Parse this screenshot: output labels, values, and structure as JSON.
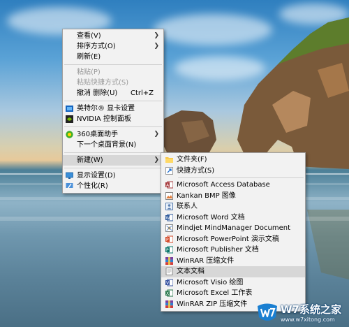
{
  "context_menu": {
    "items": [
      {
        "label": "查看(V)"
      },
      {
        "label": "排序方式(O)"
      },
      {
        "label": "刷新(E)"
      },
      {
        "label": "粘贴(P)"
      },
      {
        "label": "粘贴快捷方式(S)"
      },
      {
        "label": "撤消 删除(U)",
        "shortcut": "Ctrl+Z"
      },
      {
        "label": "英特尔® 显卡设置"
      },
      {
        "label": "NVIDIA 控制面板"
      },
      {
        "label": "360桌面助手"
      },
      {
        "label": "下一个桌面背景(N)"
      },
      {
        "label": "新建(W)"
      },
      {
        "label": "显示设置(D)"
      },
      {
        "label": "个性化(R)"
      }
    ]
  },
  "new_submenu": {
    "items": [
      {
        "label": "文件夹(F)",
        "icon": "folder-icon"
      },
      {
        "label": "快捷方式(S)",
        "icon": "shortcut-icon"
      },
      {
        "label": "Microsoft Access Database",
        "icon": "access-icon"
      },
      {
        "label": "Kankan BMP 图像",
        "icon": "bmp-image-icon"
      },
      {
        "label": "联系人",
        "icon": "contact-icon"
      },
      {
        "label": "Microsoft Word 文档",
        "icon": "word-icon"
      },
      {
        "label": "Mindjet MindManager Document",
        "icon": "mindmanager-icon"
      },
      {
        "label": "Microsoft PowerPoint 演示文稿",
        "icon": "powerpoint-icon"
      },
      {
        "label": "Microsoft Publisher 文档",
        "icon": "publisher-icon"
      },
      {
        "label": "WinRAR 压缩文件",
        "icon": "winrar-icon"
      },
      {
        "label": "文本文档",
        "icon": "text-document-icon"
      },
      {
        "label": "Microsoft Visio 绘图",
        "icon": "visio-icon"
      },
      {
        "label": "Microsoft Excel 工作表",
        "icon": "excel-icon"
      },
      {
        "label": "WinRAR ZIP 压缩文件",
        "icon": "winrar-zip-icon"
      }
    ]
  },
  "watermark": {
    "brand": "W7系统之家",
    "url": "www.w7xitong.com"
  },
  "colors": {
    "menu_bg": "#f2f2f2",
    "highlight": "#d7d7d7",
    "disabled": "#9a9a9a",
    "watermark_blue": "#1a7fd1"
  }
}
